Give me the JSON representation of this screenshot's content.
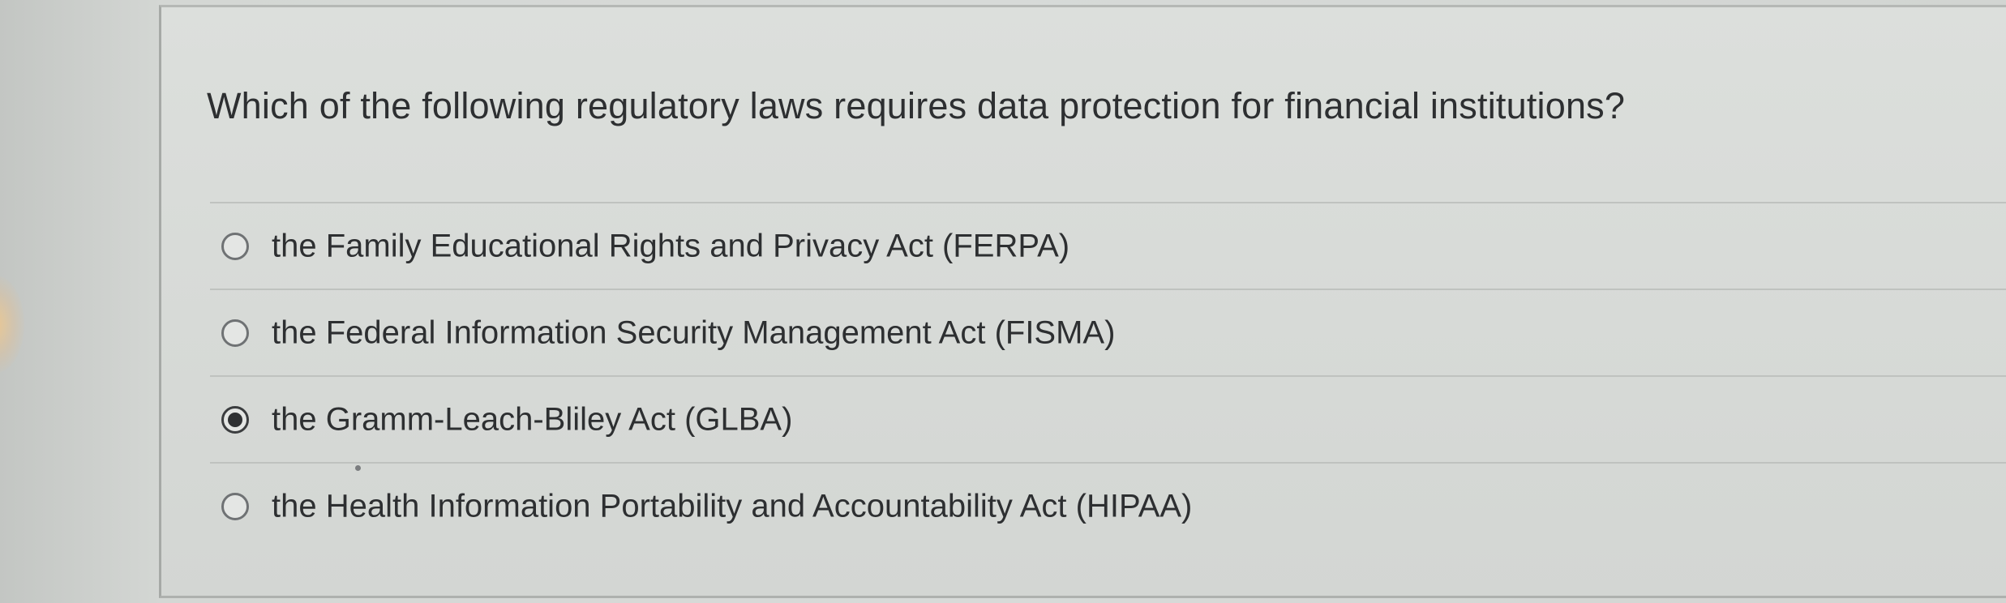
{
  "question": {
    "text": "Which of the following regulatory laws requires data protection for financial institutions?"
  },
  "options": [
    {
      "label": "the Family Educational Rights and Privacy Act (FERPA)",
      "selected": false
    },
    {
      "label": "the Federal Information Security Management Act (FISMA)",
      "selected": false
    },
    {
      "label": "the Gramm-Leach-Bliley Act (GLBA)",
      "selected": true
    },
    {
      "label": "the Health Information Portability and Accountability Act (HIPAA)",
      "selected": false
    }
  ],
  "colors": {
    "text": "#2d2f31",
    "radio_border": "#6f7274",
    "radio_selected_dot": "#2f3133",
    "divider": "#bfc2bf"
  }
}
